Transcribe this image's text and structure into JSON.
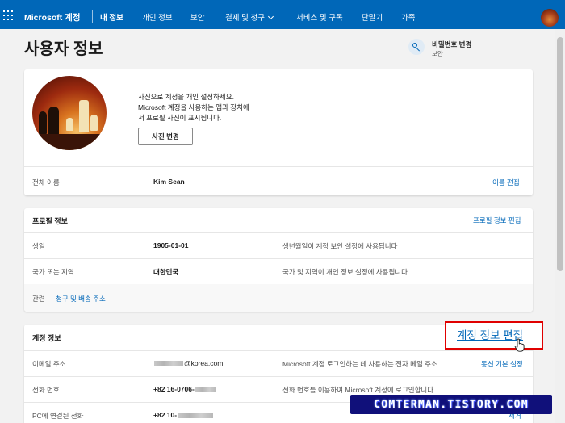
{
  "header": {
    "brand": "Microsoft 계정",
    "nav": [
      {
        "label": "내 정보",
        "active": true
      },
      {
        "label": "개인 정보"
      },
      {
        "label": "보안"
      },
      {
        "label": "결제 및 청구",
        "has_dropdown": true
      },
      {
        "label": "서비스 및 구독"
      },
      {
        "label": "단말기"
      },
      {
        "label": "가족"
      }
    ]
  },
  "page": {
    "title": "사용자 정보",
    "password_change": {
      "title": "비밀번호 변경",
      "subtitle": "보안",
      "icon": "key-icon"
    }
  },
  "photo_card": {
    "description": "사진으로 계정을 개인 설정하세요. Microsoft 계정을 사용하는 앱과 장치에서 프로필 사진이 표시됩니다.",
    "description_lines": [
      "사진으로 계정을 개인 설정하세요.",
      "Microsoft 계정을 사용하는 앱과 장치에",
      "서 프로필 사진이 표시됩니다."
    ],
    "change_photo_button": "사진 변경",
    "full_name_label": "전체 이름",
    "full_name_value": "Kim Sean",
    "edit_name_link": "이름 편집"
  },
  "profile_card": {
    "title": "프로필 정보",
    "edit_link": "프로필 정보 편집",
    "rows": [
      {
        "label": "생일",
        "value": "1905-01-01",
        "description": "생년월일이 계정 보안 설정에 사용됩니다"
      },
      {
        "label": "국가 또는 지역",
        "value": "대한민국",
        "description": "국가 및 지역이 개인 정보 설정에 사용됩니다."
      }
    ],
    "related_label": "관련",
    "related_link": "청구 및 배송 주소"
  },
  "account_card": {
    "title": "계정 정보",
    "edit_link": "계정 정보 편집",
    "rows": [
      {
        "label": "이메일 주소",
        "value_suffix": "@korea.com",
        "description": "Microsoft 계정 로그인하는 데 사용하는 전자 메일 주소",
        "link": "통신 기본 설정"
      },
      {
        "label": "전화 번호",
        "value_prefix": "+82 16-0706-",
        "description": "전화 번호를 이용하여 Microsoft 계정에 로그인합니다."
      },
      {
        "label": "PC에 연결된 전화",
        "value_prefix": "+82 10-",
        "link": "제거"
      }
    ]
  },
  "watermark": "COMTERMAN.TISTORY.COM",
  "colors": {
    "brand_blue": "#0067b8",
    "highlight_red": "#e00000",
    "watermark_bg": "#10107a"
  }
}
